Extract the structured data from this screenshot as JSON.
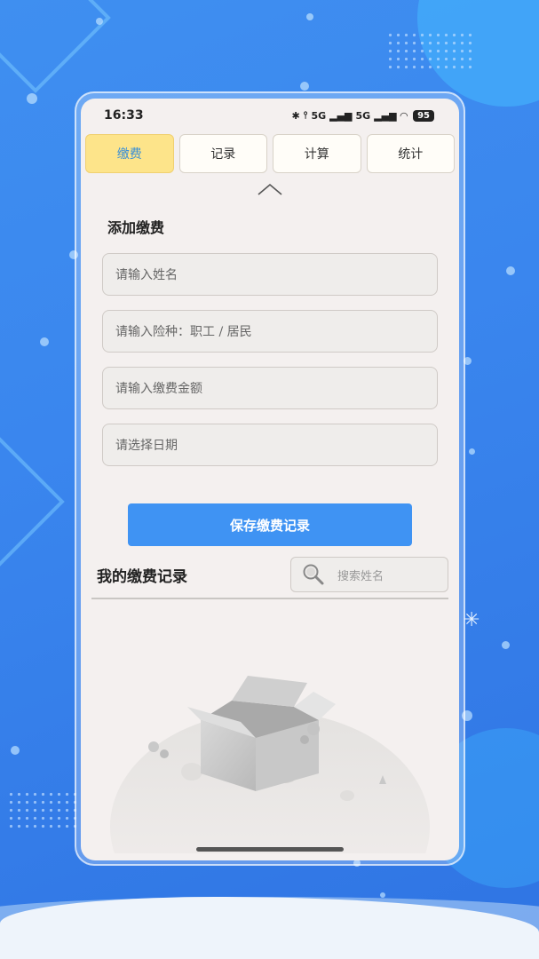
{
  "status_bar": {
    "time": "16:33",
    "network_left": "5G",
    "network_right": "5G",
    "battery": "95"
  },
  "tabs": [
    {
      "label": "缴费",
      "active": true
    },
    {
      "label": "记录",
      "active": false
    },
    {
      "label": "计算",
      "active": false
    },
    {
      "label": "统计",
      "active": false
    }
  ],
  "form": {
    "title": "添加缴费",
    "name_placeholder": "请输入姓名",
    "insurance_placeholder": "请输入险种：职工 / 居民",
    "amount_placeholder": "请输入缴费金额",
    "date_placeholder": "请选择日期",
    "save_label": "保存缴费记录"
  },
  "records": {
    "title": "我的缴费记录",
    "search_placeholder": "搜索姓名"
  },
  "colors": {
    "active_tab_bg": "#fde48a",
    "active_tab_text": "#3a8fd6",
    "save_button": "#3f93f3",
    "background": "#3a86ee"
  },
  "icons": {
    "collapse": "chevron-up-icon",
    "search": "search-icon",
    "empty": "empty-box-illustration"
  }
}
